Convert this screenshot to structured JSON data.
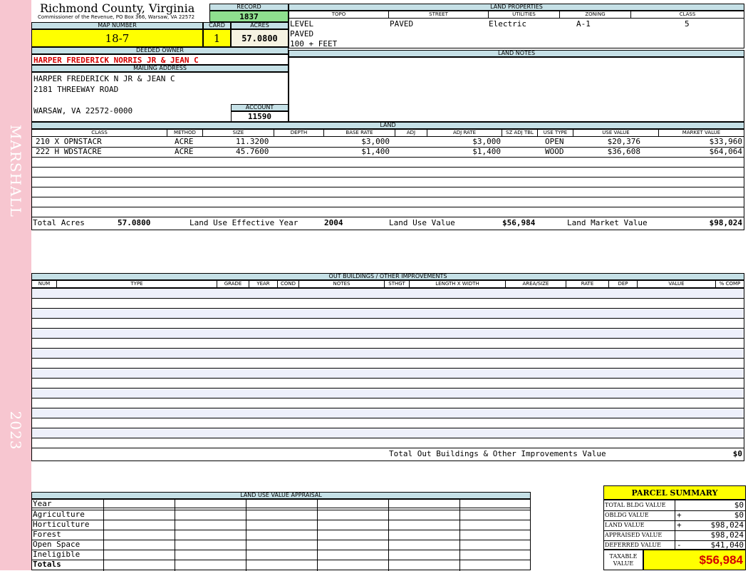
{
  "sidebar": {
    "name": "MARSHALL",
    "year": "2023"
  },
  "header": {
    "county": "Richmond County, Virginia",
    "commissioner": "Commissioner of the Revenue, PO Box 366, Warsaw, VA 22572",
    "record_label": "RECORD",
    "record": "1837",
    "map_label": "MAP NUMBER",
    "map": "18-7",
    "card_label": "CARD",
    "card": "1",
    "acres_label": "ACRES",
    "acres": "57.0800"
  },
  "owner": {
    "deeded_label": "DEEDED OWNER",
    "deeded": "HARPER FREDERICK NORRIS JR & JEAN C",
    "mailing_label": "MAILING ADDRESS",
    "mail_line1": "HARPER FREDERICK N JR & JEAN C",
    "mail_line2": "2181 THREEWAY ROAD",
    "mail_line3": "WARSAW, VA 22572-0000",
    "account_label": "ACCOUNT",
    "account": "11590"
  },
  "land_properties": {
    "label": "LAND PROPERTIES",
    "topo_label": "TOPO",
    "street_label": "STREET",
    "utilities_label": "UTILITIES",
    "zoning_label": "ZONING",
    "class_label": "CLASS",
    "topo": [
      "LEVEL",
      "PAVED",
      "100 + FEET"
    ],
    "street": "PAVED",
    "utilities": "Electric",
    "zoning": "A-1",
    "class": "5"
  },
  "land_notes": {
    "label": "LAND NOTES"
  },
  "land": {
    "label": "LAND",
    "headers": [
      "CLASS",
      "METHOD",
      "SIZE",
      "DEPTH",
      "BASE RATE",
      "ADJ",
      "ADJ RATE",
      "SZ ADJ TBL",
      "USE TYPE",
      "USE VALUE",
      "MARKET VALUE"
    ],
    "rows": [
      {
        "class": "210 X OPNSTACR",
        "method": "ACRE",
        "size": "11.3200",
        "depth": "",
        "base_rate": "$3,000",
        "adj": "",
        "adj_rate": "$3,000",
        "sz": "",
        "use_type": "OPEN",
        "use_value": "$20,376",
        "market": "$33,960"
      },
      {
        "class": "222 H WDSTACRE",
        "method": "ACRE",
        "size": "45.7600",
        "depth": "",
        "base_rate": "$1,400",
        "adj": "",
        "adj_rate": "$1,400",
        "sz": "",
        "use_type": "WOOD",
        "use_value": "$36,608",
        "market": "$64,064"
      }
    ],
    "total_acres_label": "Total Acres",
    "total_acres": "57.0800",
    "effective_year_label": "Land Use Effective Year",
    "effective_year": "2004",
    "use_value_label": "Land Use Value",
    "use_value": "$56,984",
    "market_value_label": "Land Market Value",
    "market_value": "$98,024"
  },
  "outbuildings": {
    "label": "OUT BUILDINGS / OTHER IMPROVEMENTS",
    "headers": [
      "NUM",
      "TYPE",
      "GRADE",
      "YEAR",
      "COND",
      "NOTES",
      "STHGT",
      "LENGTH X WIDTH",
      "AREA/SIZE",
      "RATE",
      "DEP",
      "VALUE",
      "% COMP"
    ],
    "total_label": "Total Out Buildings & Other Improvements Value",
    "total": "$0"
  },
  "land_use_appraisal": {
    "label": "LAND USE VALUE APPRAISAL",
    "rows": [
      "Year",
      "Agriculture",
      "Horticulture",
      "Forest",
      "Open Space",
      "Ineligible",
      "Totals"
    ]
  },
  "parcel_summary": {
    "title": "PARCEL SUMMARY",
    "rows": [
      {
        "label": "TOTAL BLDG VALUE",
        "sign": "",
        "value": "$0"
      },
      {
        "label": "OBLDG VALUE",
        "sign": "+",
        "value": "$0"
      },
      {
        "label": "LAND VALUE",
        "sign": "+",
        "value": "$98,024"
      },
      {
        "label": "APPRAISED VALUE",
        "sign": "",
        "value": "$98,024"
      },
      {
        "label": "DEFERRED VALUE",
        "sign": "-",
        "value": "$41,040"
      }
    ],
    "taxable_label": "TAXABLE VALUE",
    "taxable": "$56,984"
  }
}
